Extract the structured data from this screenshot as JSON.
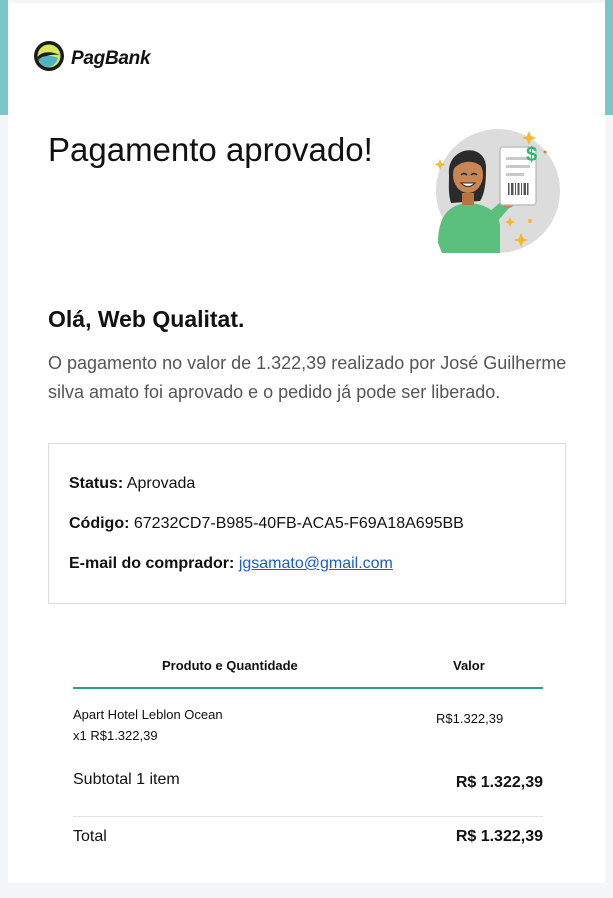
{
  "brand": {
    "name": "PagBank",
    "accent_color": "#7bc6c9",
    "table_line_color": "#2a9d8f",
    "link_color": "#1a5ec5"
  },
  "email": {
    "title": "Pagamento aprovado!",
    "greeting": "Olá, Web Qualitat.",
    "message": "O pagamento no valor de 1.322,39 realizado por José Guilherme silva amato foi aprovado e o pedido já pode ser liberado."
  },
  "details": {
    "status_label": "Status:",
    "status_value": "Aprovada",
    "code_label": "Código:",
    "code_value": "67232CD7-B985-40FB-ACA5-F69A18A695BB",
    "email_label": "E-mail do comprador:",
    "email_value": "jgsamato@gmail.com"
  },
  "order": {
    "headers": {
      "product": "Produto e Quantidade",
      "value": "Valor"
    },
    "items": [
      {
        "name": "Apart Hotel Leblon Ocean",
        "quantity_line": "x1 R$1.322,39",
        "value": "R$1.322,39"
      }
    ],
    "subtotal_label": "Subtotal 1 item",
    "subtotal_value": "R$ 1.322,39",
    "total_label": "Total",
    "total_value": "R$ 1.322,39"
  },
  "icons": {
    "logo": "pagbank-logo-icon",
    "illustration": "woman-holding-receipt-illustration"
  }
}
